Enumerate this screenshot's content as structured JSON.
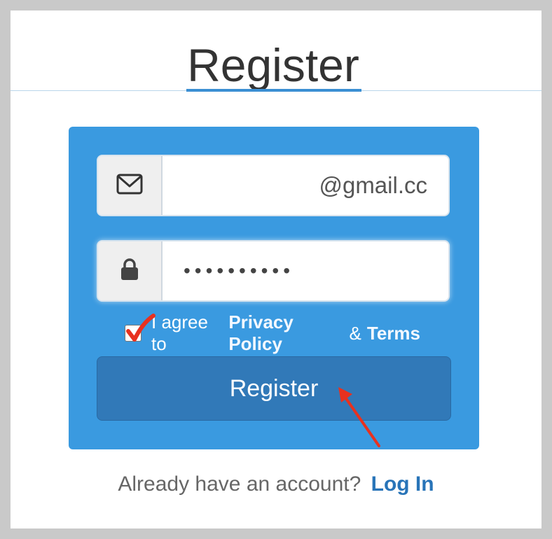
{
  "page": {
    "title": "Register"
  },
  "form": {
    "email": {
      "icon": "envelope-icon",
      "value": "@gmail.cc"
    },
    "password": {
      "icon": "lock-icon",
      "value": "••••••••••"
    },
    "agree": {
      "checked": true,
      "prefix": "I agree to",
      "privacy_link": "Privacy Policy",
      "ampersand": "&",
      "terms_link": "Terms"
    },
    "submit_label": "Register"
  },
  "footer": {
    "prompt": "Already have an account?",
    "login_link": "Log In"
  },
  "annotations": {
    "check_mark_icon": "red-check-mark-icon",
    "arrow_icon": "red-arrow-icon"
  },
  "colors": {
    "panel": "#3a9ae0",
    "button": "#3179b8",
    "link": "#2874b8",
    "annotation": "#e8311f"
  }
}
